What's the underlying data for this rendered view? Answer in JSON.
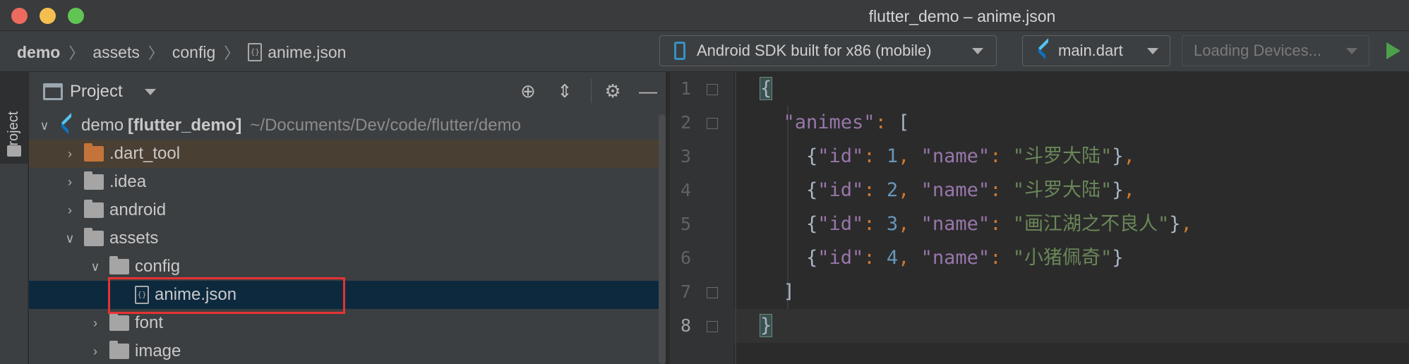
{
  "window": {
    "title": "flutter_demo – anime.json"
  },
  "breadcrumb": [
    "demo",
    "assets",
    "config",
    "anime.json"
  ],
  "toolbar": {
    "device": "Android SDK built for x86 (mobile)",
    "config": "main.dart",
    "devices_loading": "Loading Devices..."
  },
  "toolstrip": {
    "project_tab": "Project"
  },
  "project": {
    "title": "Project",
    "root": {
      "name": "demo",
      "module": "[flutter_demo]",
      "path": "~/Documents/Dev/code/flutter/demo"
    },
    "items": [
      {
        "label": ".dart_tool",
        "icon": "folder-orange",
        "level": 1,
        "expanded": false
      },
      {
        "label": ".idea",
        "icon": "folder-settings",
        "level": 1,
        "expanded": false
      },
      {
        "label": "android",
        "icon": "folder-android",
        "level": 1,
        "expanded": false
      },
      {
        "label": "assets",
        "icon": "folder",
        "level": 1,
        "expanded": true
      },
      {
        "label": "config",
        "icon": "folder",
        "level": 2,
        "expanded": true
      },
      {
        "label": "anime.json",
        "icon": "json-file",
        "level": 3,
        "selected": true
      },
      {
        "label": "font",
        "icon": "folder",
        "level": 2,
        "expanded": false
      },
      {
        "label": "image",
        "icon": "folder",
        "level": 2,
        "expanded": false
      }
    ]
  },
  "editor": {
    "line_numbers": [
      "1",
      "2",
      "3",
      "4",
      "5",
      "6",
      "7",
      "8"
    ],
    "current_line": 8,
    "file_content": "{\n  \"animes\": [\n    {\"id\": 1, \"name\": \"斗罗大陆\"},\n    {\"id\": 2, \"name\": \"斗罗大陆\"},\n    {\"id\": 3, \"name\": \"画江湖之不良人\"},\n    {\"id\": 4, \"name\": \"小猪佩奇\"}\n  ]\n}",
    "key_animes": "\"animes\"",
    "entries": [
      {
        "id": "1",
        "name": "\"斗罗大陆\""
      },
      {
        "id": "2",
        "name": "\"斗罗大陆\""
      },
      {
        "id": "3",
        "name": "\"画江湖之不良人\""
      },
      {
        "id": "4",
        "name": "\"小猪佩奇\""
      }
    ]
  },
  "colors": {
    "keyword": "#9876aa",
    "number": "#6897bb",
    "string": "#6a8759",
    "punct": "#cc7832",
    "highlight_box": "#e53333"
  }
}
